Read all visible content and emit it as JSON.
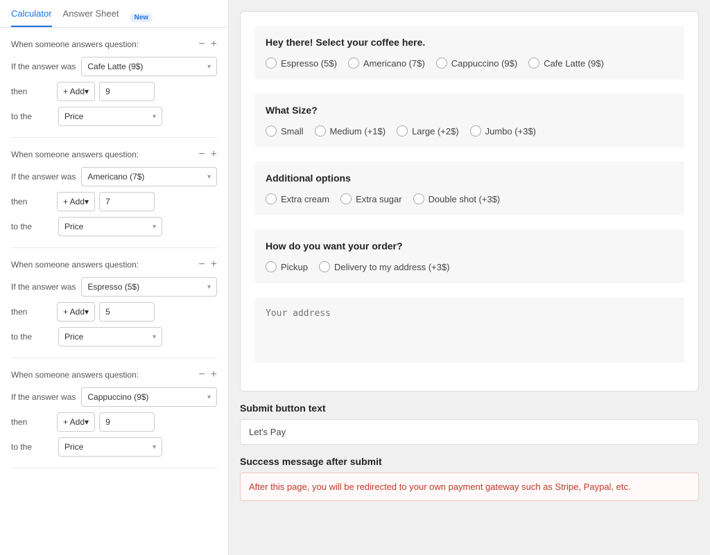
{
  "tabs": {
    "calculator": {
      "label": "Calculator",
      "active": true
    },
    "answer_sheet": {
      "label": "Answer Sheet"
    },
    "badge_new": "New"
  },
  "rules": [
    {
      "header": "When someone answers question:",
      "if_label": "If the answer was",
      "answer": "Cafe Latte (9$)",
      "then_label": "then",
      "operation": "+ Add",
      "value": "9",
      "to_the_label": "to the",
      "field": "Price"
    },
    {
      "header": "When someone answers question:",
      "if_label": "If the answer was",
      "answer": "Americano (7$)",
      "then_label": "then",
      "operation": "+ Add",
      "value": "7",
      "to_the_label": "to the",
      "field": "Price"
    },
    {
      "header": "When someone answers question:",
      "if_label": "If the answer was",
      "answer": "Espresso (5$)",
      "then_label": "then",
      "operation": "+ Add",
      "value": "5",
      "to_the_label": "to the",
      "field": "Price"
    },
    {
      "header": "When someone answers question:",
      "if_label": "If the answer was",
      "answer": "Cappuccino (9$)",
      "then_label": "then",
      "operation": "+ Add",
      "value": "9",
      "to_the_label": "to the",
      "field": "Price"
    }
  ],
  "form": {
    "coffee_question": {
      "title": "Hey there! Select your coffee here.",
      "options": [
        {
          "label": "Espresso (5$)"
        },
        {
          "label": "Americano (7$)"
        },
        {
          "label": "Cappuccino (9$)"
        },
        {
          "label": "Cafe Latte (9$)"
        }
      ]
    },
    "size_question": {
      "title": "What Size?",
      "options": [
        {
          "label": "Small"
        },
        {
          "label": "Medium (+1$)"
        },
        {
          "label": "Large (+2$)"
        },
        {
          "label": "Jumbo (+3$)"
        }
      ]
    },
    "additional_question": {
      "title": "Additional options",
      "options": [
        {
          "label": "Extra cream"
        },
        {
          "label": "Extra sugar"
        },
        {
          "label": "Double shot (+3$)"
        }
      ]
    },
    "order_question": {
      "title": "How do you want your order?",
      "options": [
        {
          "label": "Pickup"
        },
        {
          "label": "Delivery to my address (+3$)"
        }
      ]
    },
    "address_placeholder": "Your address",
    "submit_section": {
      "label": "Submit button text",
      "value": "Let's Pay"
    },
    "success_section": {
      "label": "Success message after submit",
      "message": "After this page, you will be redirected to your own payment gateway such as Stripe, Paypal, etc."
    }
  }
}
